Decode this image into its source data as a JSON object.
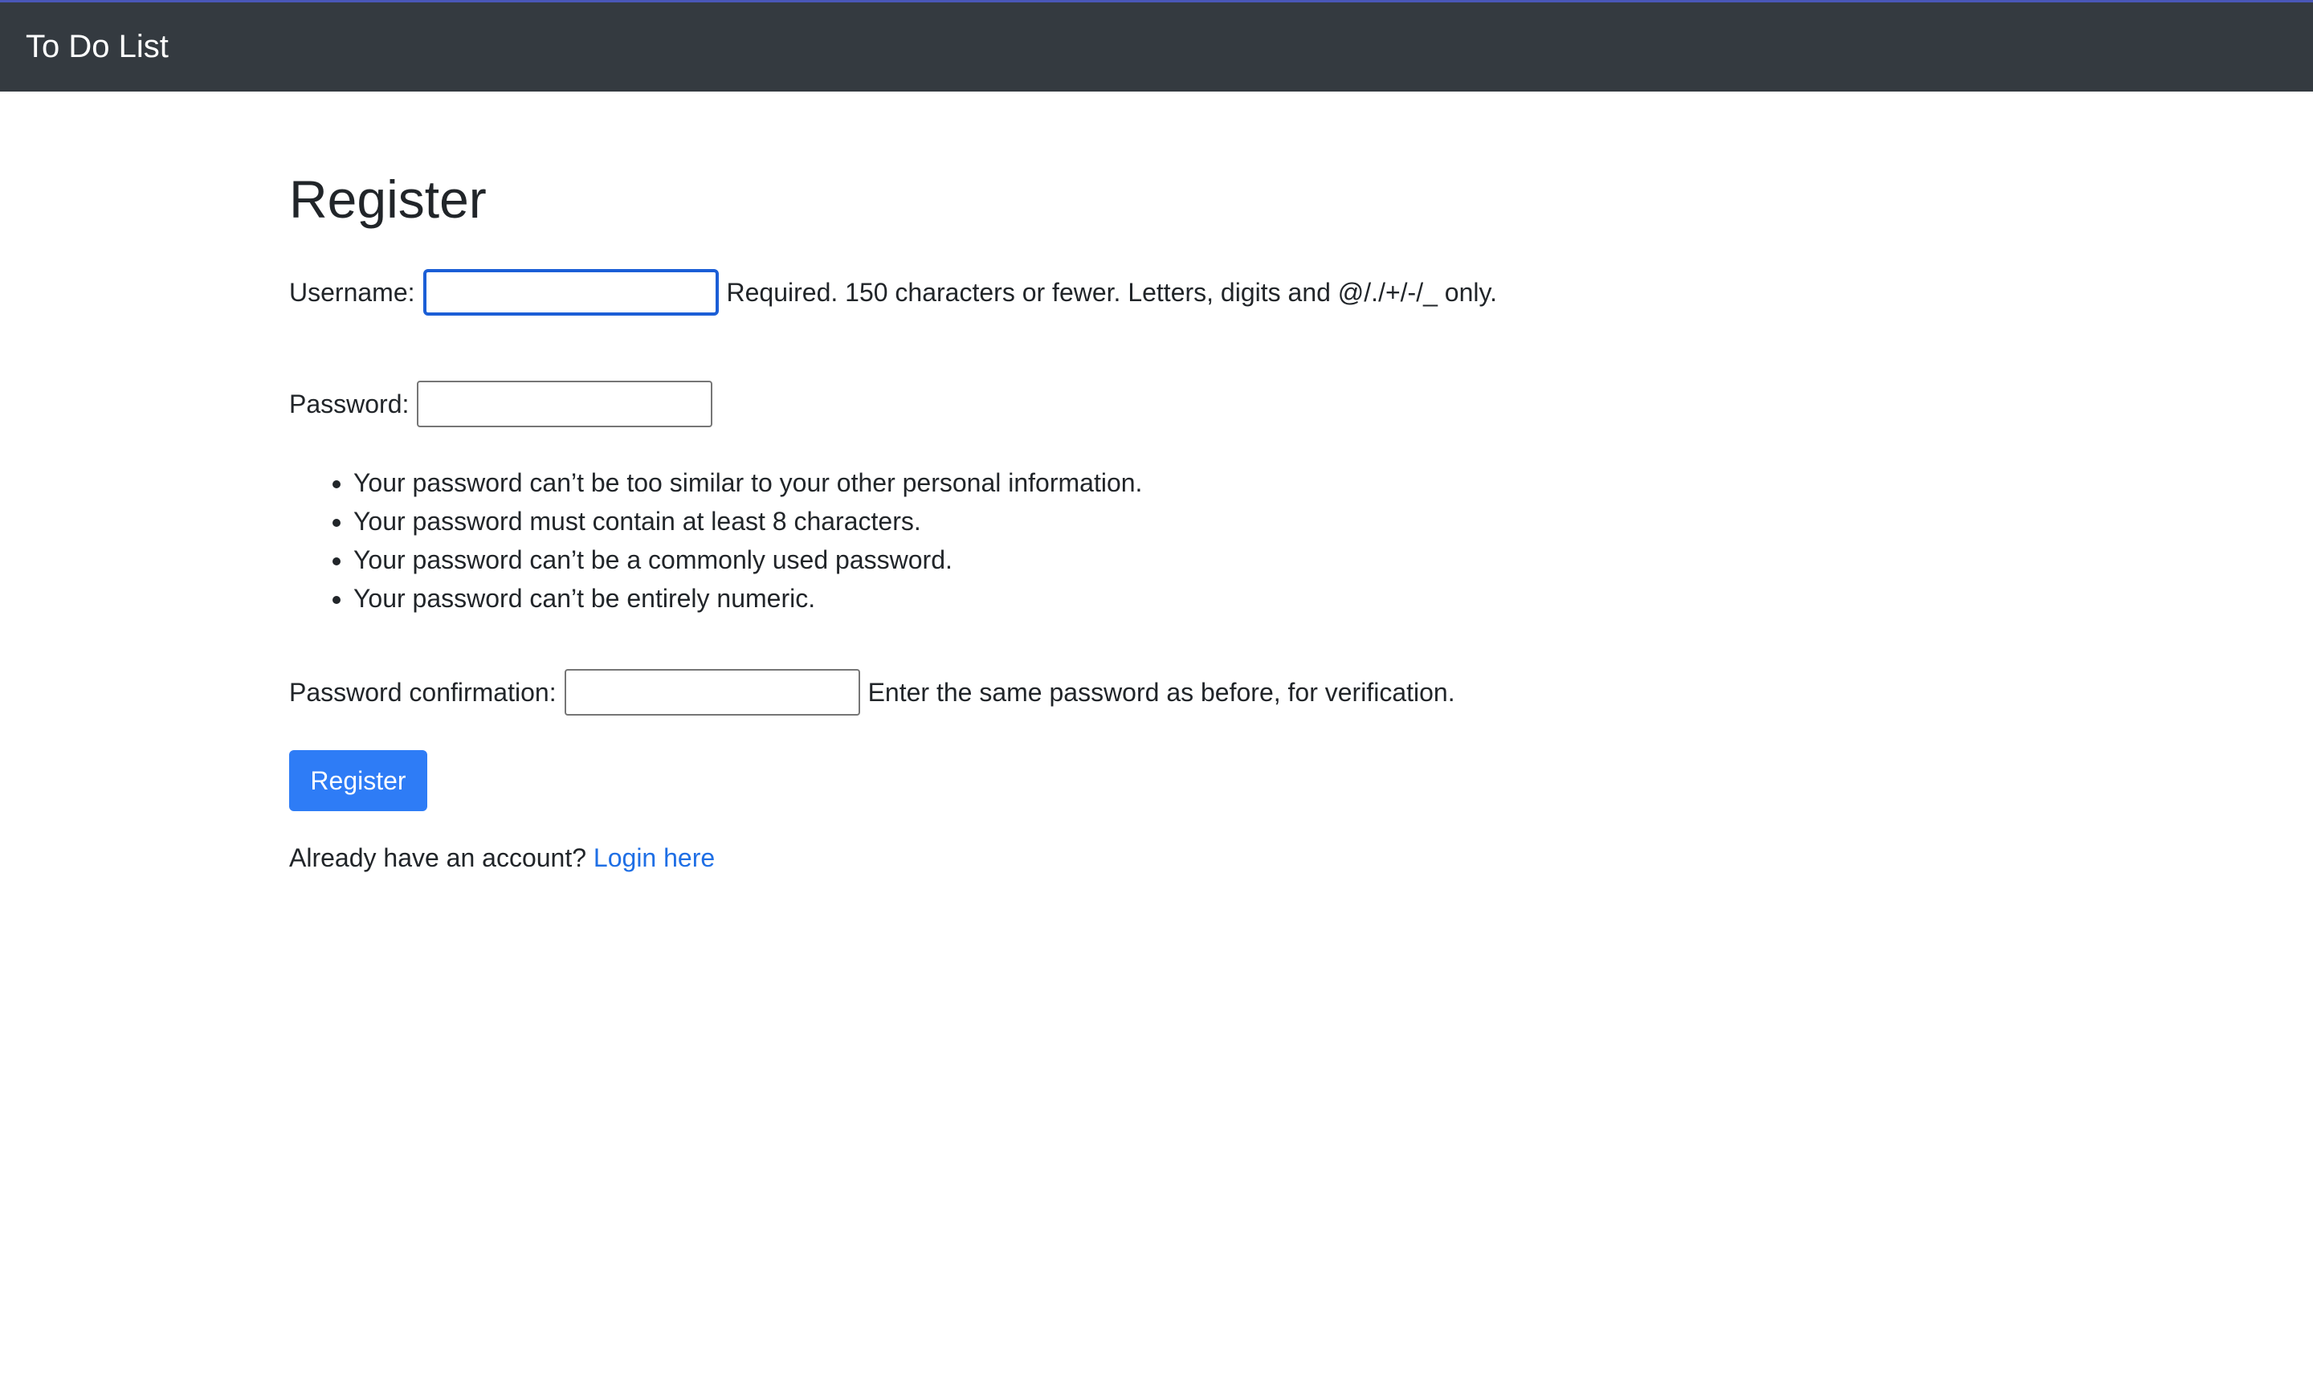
{
  "navbar": {
    "brand": "To Do List"
  },
  "page": {
    "title": "Register"
  },
  "form": {
    "username": {
      "label": "Username:",
      "value": "",
      "help": "Required. 150 characters or fewer. Letters, digits and @/./+/-/_ only."
    },
    "password": {
      "label": "Password:",
      "value": "",
      "rules": [
        "Your password can’t be too similar to your other personal information.",
        "Your password must contain at least 8 characters.",
        "Your password can’t be a commonly used password.",
        "Your password can’t be entirely numeric."
      ]
    },
    "password_confirmation": {
      "label": "Password confirmation:",
      "value": "",
      "help": "Enter the same password as before, for verification."
    },
    "submit_label": "Register"
  },
  "footer": {
    "prompt": "Already have an account?",
    "link_label": "Login here"
  },
  "colors": {
    "navbar_bg": "#343a40",
    "primary_button": "#2e7cf6",
    "link": "#1f6fe5",
    "focus_border": "#1b5ed6"
  }
}
